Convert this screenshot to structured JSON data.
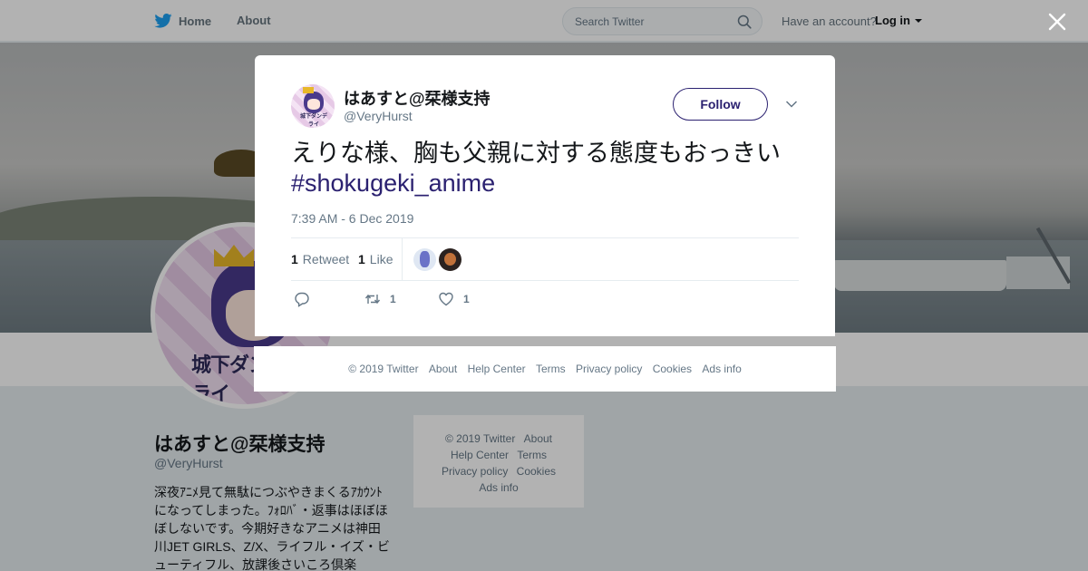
{
  "colors": {
    "twitter_blue": "#1da1f2",
    "accent": "#2b2170",
    "text_secondary": "#657786"
  },
  "topbar": {
    "home_label": "Home",
    "about_label": "About",
    "search_placeholder": "Search Twitter",
    "account_prompt": "Have an account?",
    "login_label": "Log in"
  },
  "profile": {
    "name": "はあすと@栞様支持",
    "handle": "@VeryHurst",
    "avatar_logo": "城下ダンデライ",
    "bio": "深夜ｱﾆﾒ見て無駄につぶやきまくるｱｶｳﾝﾄになってしまった。ﾌｫﾛﾊﾞ・返事はほぼほぼしないです。今期好きなアニメは神田川JET GIRLS、Z/X、ライフル・イズ・ビューティフル、放課後さいころ倶楽"
  },
  "profile_footer": {
    "copyright": "© 2019 Twitter",
    "about": "About",
    "help": "Help Center",
    "terms": "Terms",
    "privacy": "Privacy policy",
    "cookies": "Cookies",
    "ads": "Ads info"
  },
  "tweet": {
    "author_name": "はあすと@栞様支持",
    "author_handle": "@VeryHurst",
    "follow_label": "Follow",
    "text_line1": "えりな様、胸も父親に対する態度もおっきい",
    "hashtag": "#shokugeki_anime",
    "timestamp": "7:39 AM - 6 Dec 2019",
    "retweet_count": "1",
    "retweet_label": "Retweet",
    "like_count": "1",
    "like_label": "Like",
    "action_retweet_count": "1",
    "action_like_count": "1"
  },
  "modal_footer": {
    "copyright": "© 2019 Twitter",
    "about": "About",
    "help": "Help Center",
    "terms": "Terms",
    "privacy": "Privacy policy",
    "cookies": "Cookies",
    "ads": "Ads info"
  },
  "icons": {
    "brand": "twitter-bird-icon",
    "search": "search-icon",
    "close": "close-icon",
    "menu": "chevron-down-icon",
    "reply": "reply-icon",
    "retweet": "retweet-icon",
    "like": "heart-icon"
  }
}
